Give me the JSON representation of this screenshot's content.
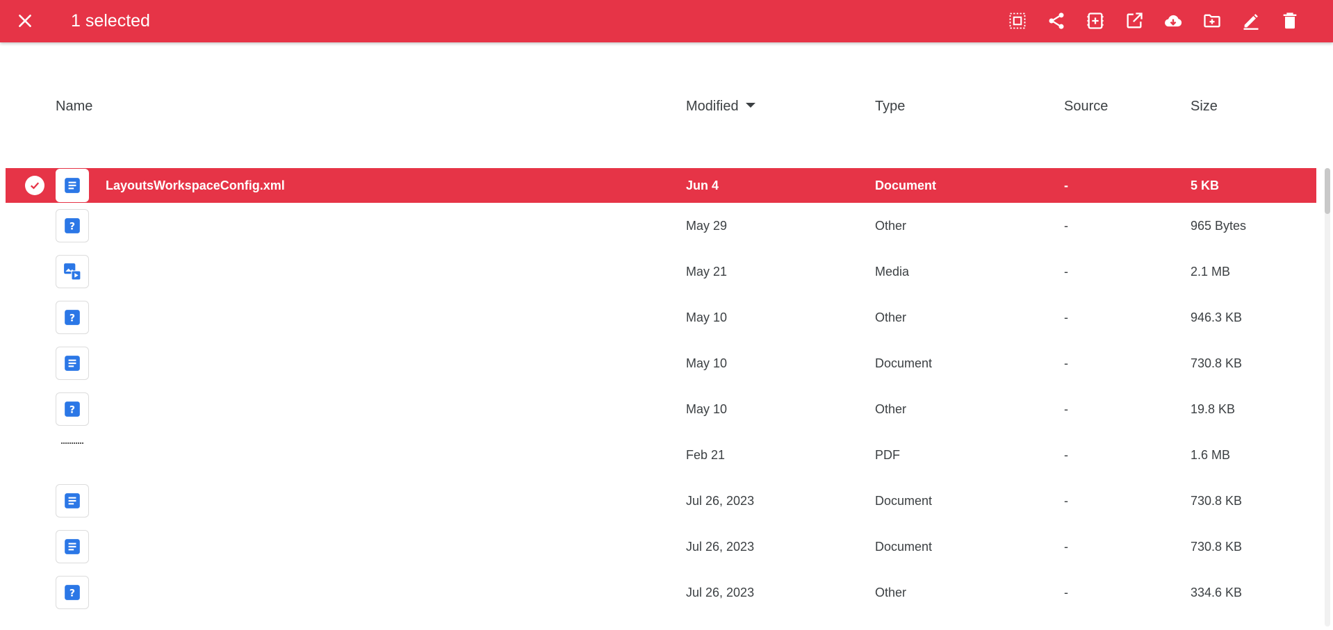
{
  "appbar": {
    "title": "1 selected",
    "accent": "#e63447",
    "close_icon": "close-icon",
    "actions": [
      {
        "name": "select-all-button",
        "icon": "select-all-icon"
      },
      {
        "name": "share-button",
        "icon": "share-icon"
      },
      {
        "name": "add-to-button",
        "icon": "add-box-icon"
      },
      {
        "name": "open-external-button",
        "icon": "open-in-new-icon"
      },
      {
        "name": "download-button",
        "icon": "cloud-download-icon"
      },
      {
        "name": "move-to-folder-button",
        "icon": "folder-plus-icon"
      },
      {
        "name": "rename-button",
        "icon": "pencil-icon"
      },
      {
        "name": "delete-button",
        "icon": "trash-icon"
      }
    ]
  },
  "table": {
    "columns": {
      "name": "Name",
      "modified": "Modified",
      "type": "Type",
      "source": "Source",
      "size": "Size"
    },
    "sort_column": "Modified",
    "rows": [
      {
        "name": "LayoutsWorkspaceConfig.xml",
        "modified": "Jun 4",
        "type": "Document",
        "source": "-",
        "size": "5 KB",
        "icon": "document-icon",
        "selected": true
      },
      {
        "name": "",
        "modified": "May 29",
        "type": "Other",
        "source": "-",
        "size": "965 Bytes",
        "icon": "unknown-file-icon",
        "selected": false
      },
      {
        "name": "",
        "modified": "May 21",
        "type": "Media",
        "source": "-",
        "size": "2.1 MB",
        "icon": "media-icon",
        "selected": false
      },
      {
        "name": "",
        "modified": "May 10",
        "type": "Other",
        "source": "-",
        "size": "946.3 KB",
        "icon": "unknown-file-icon",
        "selected": false
      },
      {
        "name": "",
        "modified": "May 10",
        "type": "Document",
        "source": "-",
        "size": "730.8 KB",
        "icon": "document-icon",
        "selected": false
      },
      {
        "name": "",
        "modified": "May 10",
        "type": "Other",
        "source": "-",
        "size": "19.8 KB",
        "icon": "unknown-file-icon",
        "selected": false
      },
      {
        "name": "",
        "modified": "Feb 21",
        "type": "PDF",
        "source": "-",
        "size": "1.6 MB",
        "icon": "pdf-thumbnail",
        "selected": false
      },
      {
        "name": "",
        "modified": "Jul 26, 2023",
        "type": "Document",
        "source": "-",
        "size": "730.8 KB",
        "icon": "document-icon",
        "selected": false
      },
      {
        "name": "",
        "modified": "Jul 26, 2023",
        "type": "Document",
        "source": "-",
        "size": "730.8 KB",
        "icon": "document-icon",
        "selected": false
      },
      {
        "name": "",
        "modified": "Jul 26, 2023",
        "type": "Other",
        "source": "-",
        "size": "334.6 KB",
        "icon": "unknown-file-icon",
        "selected": false
      }
    ]
  }
}
